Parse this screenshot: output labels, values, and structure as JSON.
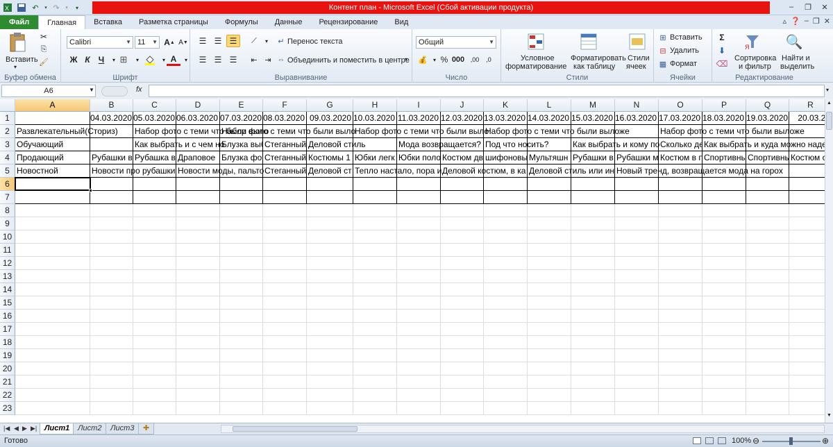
{
  "window": {
    "title": "Контент план  -  Microsoft Excel (Сбой активации продукта)"
  },
  "tabs": [
    {
      "label": "Файл",
      "kind": "file"
    },
    {
      "label": "Главная",
      "kind": "active"
    },
    {
      "label": "Вставка"
    },
    {
      "label": "Разметка страницы"
    },
    {
      "label": "Формулы"
    },
    {
      "label": "Данные"
    },
    {
      "label": "Рецензирование"
    },
    {
      "label": "Вид"
    }
  ],
  "ribbon": {
    "clipboard": {
      "paste": "Вставить",
      "label": "Буфер обмена"
    },
    "font": {
      "name": "Calibri",
      "size": "11",
      "bold": "Ж",
      "italic": "К",
      "underline": "Ч",
      "label": "Шрифт"
    },
    "alignment": {
      "wrap": "Перенос текста",
      "merge": "Объединить и поместить в центре",
      "label": "Выравнивание"
    },
    "number": {
      "format": "Общий",
      "label": "Число"
    },
    "styles": {
      "conditional1": "Условное",
      "conditional2": "форматирование",
      "astable1": "Форматировать",
      "astable2": "как таблицу",
      "cellstyles1": "Стили",
      "cellstyles2": "ячеек",
      "label": "Стили"
    },
    "cells": {
      "insert": "Вставить",
      "delete": "Удалить",
      "format": "Формат",
      "label": "Ячейки"
    },
    "editing": {
      "sort1": "Сортировка",
      "sort2": "и фильтр",
      "find1": "Найти и",
      "find2": "выделить",
      "label": "Редактирование"
    }
  },
  "formula_bar": {
    "name_box": "A6",
    "fx": "fx",
    "value": ""
  },
  "sheet": {
    "columns": [
      "A",
      "B",
      "C",
      "D",
      "E",
      "F",
      "G",
      "H",
      "I",
      "J",
      "K",
      "L",
      "M",
      "N",
      "O",
      "P",
      "Q",
      "R"
    ],
    "row1": [
      "",
      "04.03.2020",
      "05.03.2020",
      "06.03.2020",
      "07.03.2020",
      "08.03.2020",
      "09.03.2020",
      "10.03.2020",
      "11.03.2020",
      "12.03.2020",
      "13.03.2020",
      "14.03.2020",
      "15.03.2020",
      "16.03.2020",
      "17.03.2020",
      "18.03.2020",
      "19.03.2020",
      "20.03.20"
    ],
    "row2": [
      "Развлекательный(Сториз)",
      "",
      "Набор фото с теми что были выло",
      "",
      "Набор фото с теми что были выло",
      "",
      "",
      "Набор фото с теми что были выло",
      "",
      "",
      "Набор фото с теми что были выложе",
      "",
      "",
      "",
      "Набор фото с теми что были выложе",
      "",
      "",
      ""
    ],
    "row3": [
      "Обучающий",
      "",
      "Как выбрать и с чем но",
      "",
      "Блузка выб",
      "Стеганный",
      "Деловой стиль",
      "",
      "Мода возвращается?",
      "",
      "Под что носить?",
      "",
      "Как выбрать и кому по",
      "",
      "Сколько де",
      "Как выбрать и куда можно наде",
      "",
      ""
    ],
    "row4": [
      "Продающий",
      "Рубашки в",
      "Рубашка в",
      "Драповое",
      "Блузка фо",
      "Стеганный",
      "Костюмы 1",
      "Юбки легк",
      "Юбки поло",
      "Костюм дв",
      "шифоновы",
      "Мультяшн",
      "Рубашки в",
      "Рубашки м",
      "Костюм в п",
      "Спортивны",
      "Спортивны",
      "Костюм с"
    ],
    "row5": [
      "Новостной",
      "Новости про рубашки",
      "",
      "Новости моды, пальто",
      "",
      "Стеганный",
      "Деловой ст",
      "Тепло настало, пора и",
      "",
      "Деловой костюм, в ка",
      "",
      "Деловой стиль или ин",
      "",
      "Новый тренд, возвращается мода на горох",
      "",
      "",
      "",
      ""
    ],
    "row_numbers": [
      "1",
      "2",
      "3",
      "4",
      "5",
      "6",
      "7",
      "8",
      "9",
      "10",
      "11",
      "12",
      "13",
      "14",
      "15",
      "16",
      "17",
      "18",
      "19",
      "20",
      "21",
      "22",
      "23"
    ]
  },
  "sheet_tabs": [
    "Лист1",
    "Лист2",
    "Лист3"
  ],
  "status": {
    "ready": "Готово",
    "zoom": "100%"
  }
}
